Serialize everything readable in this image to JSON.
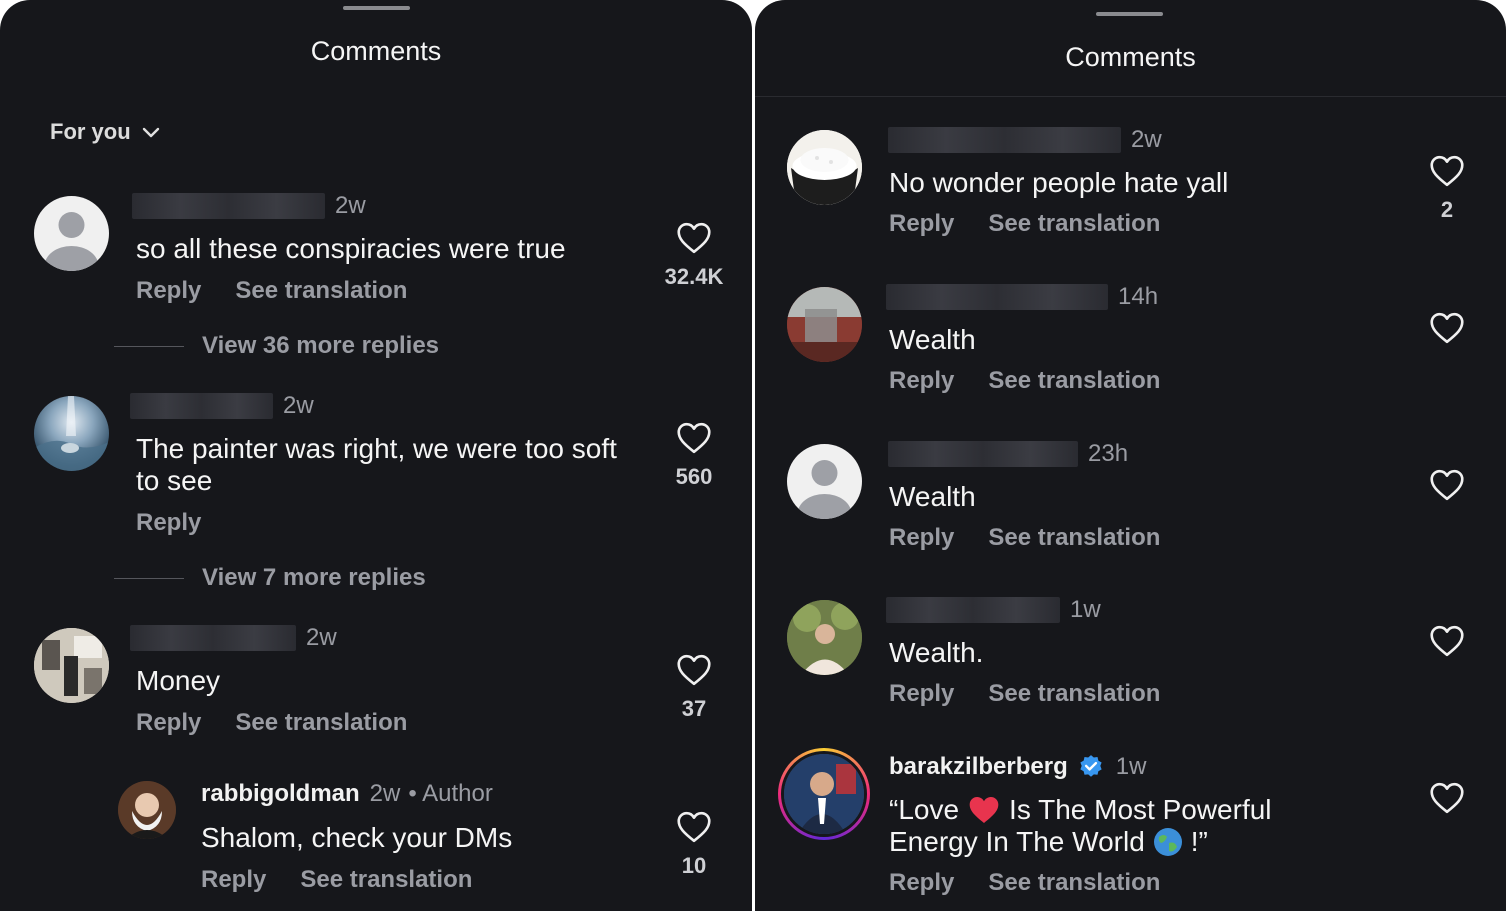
{
  "left": {
    "title": "Comments",
    "sort_label": "For you",
    "comments": [
      {
        "time": "2w",
        "text": "so all these conspiracies were true",
        "reply": "Reply",
        "translate": "See translation",
        "likes": "32.4K",
        "more": "View 36 more replies"
      },
      {
        "time": "2w",
        "text": "The painter was right, we were too soft to see",
        "reply": "Reply",
        "likes": "560",
        "more": "View 7 more replies"
      },
      {
        "time": "2w",
        "text": "Money",
        "reply": "Reply",
        "translate": "See translation",
        "likes": "37"
      },
      {
        "username": "rabbigoldman",
        "time": "2w",
        "author": "• Author",
        "text": "Shalom, check your DMs",
        "reply": "Reply",
        "translate": "See translation",
        "likes": "10"
      }
    ]
  },
  "right": {
    "title": "Comments",
    "comments": [
      {
        "time": "2w",
        "text": "No wonder people hate yall",
        "reply": "Reply",
        "translate": "See translation",
        "likes": "2"
      },
      {
        "time": "14h",
        "text": "Wealth",
        "reply": "Reply",
        "translate": "See translation"
      },
      {
        "time": "23h",
        "text": "Wealth",
        "reply": "Reply",
        "translate": "See translation"
      },
      {
        "time": "1w",
        "text": "Wealth.",
        "reply": "Reply",
        "translate": "See translation"
      },
      {
        "username": "barakzilberberg",
        "time": "1w",
        "text_line1_a": "“Love",
        "text_line1_b": "Is The Most Powerful",
        "text_line2_a": "Energy In The World",
        "text_line2_b": "!”",
        "reply": "Reply",
        "translate": "See translation"
      }
    ]
  },
  "icons": {
    "chevron": "chevron-down-icon",
    "heart": "heart-outline-icon",
    "verified": "verified-badge-icon",
    "red_heart": "red-heart-emoji",
    "globe": "globe-emoji"
  },
  "colors": {
    "background": "#16171b",
    "primary_text": "#f5f5f5",
    "secondary_text": "#9a9ca3",
    "verified_blue": "#3897f0",
    "heart_red": "#e8344e"
  }
}
